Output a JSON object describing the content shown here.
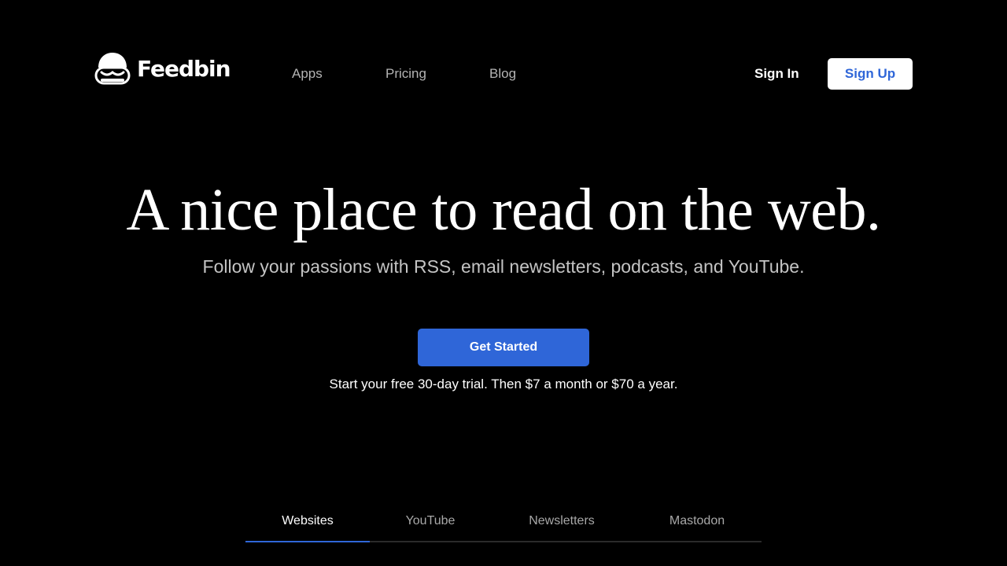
{
  "brand": {
    "name": "Feedbin",
    "accent_color": "#2f66d8",
    "logo_icon": "feedbin-logo-icon"
  },
  "nav": {
    "items": [
      {
        "label": "Apps"
      },
      {
        "label": "Pricing"
      },
      {
        "label": "Blog"
      }
    ]
  },
  "auth": {
    "sign_in_label": "Sign In",
    "sign_up_label": "Sign Up"
  },
  "hero": {
    "title": "A nice place to read on the web.",
    "subtitle": "Follow your passions with RSS, email newsletters, podcasts, and YouTube.",
    "cta_label": "Get Started",
    "trial_text": "Start your free 30-day trial. Then $7 a month or $70 a year."
  },
  "tabs": {
    "active": "Websites",
    "items": [
      {
        "label": "Websites"
      },
      {
        "label": "YouTube"
      },
      {
        "label": "Newsletters"
      },
      {
        "label": "Mastodon"
      }
    ]
  }
}
